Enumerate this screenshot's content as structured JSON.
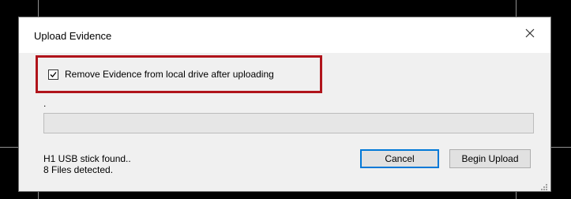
{
  "dialog": {
    "title": "Upload Evidence",
    "close_icon": "close-icon",
    "remove_checkbox": {
      "label": "Remove Evidence from local drive after uploading",
      "checked": true
    },
    "status_dot": ".",
    "progress": {
      "value": 0
    },
    "status": {
      "line1": "H1 USB stick found..",
      "line2": "8 Files detected."
    },
    "buttons": {
      "cancel_label": "Cancel",
      "begin_label": "Begin Upload"
    }
  },
  "colors": {
    "highlight_border": "#b0141b",
    "focus_border": "#0078d7",
    "dialog_bg": "#f0f0f0",
    "title_bg": "#ffffff"
  }
}
